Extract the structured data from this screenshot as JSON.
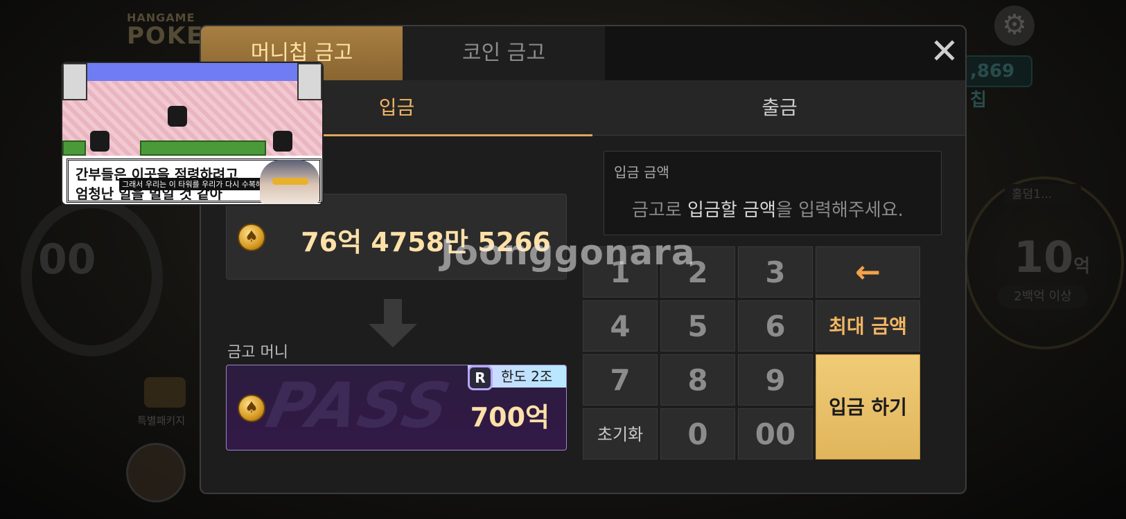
{
  "background": {
    "logo_small": "HANGAME",
    "logo_big": "POKE",
    "chip_pill": ",869 칩",
    "left_amount": "00",
    "right_amount": "10",
    "right_amount_unit": "억",
    "right_sub": "2백억 이상",
    "right_tag": "홀덤1...",
    "package_label": "특별패키지"
  },
  "dialog": {
    "tabs": [
      {
        "label": "머니칩 금고",
        "active": true
      },
      {
        "label": "코인 금고",
        "active": false
      }
    ],
    "close_icon": "close-icon",
    "subtabs": [
      {
        "label": "입금",
        "active": true
      },
      {
        "label": "출금",
        "active": false
      }
    ],
    "current_amount": "76억 4758만 5266",
    "safe_label": "금고 머니",
    "safe_pass_text": "PASS",
    "limit_badge": "한도 2조",
    "limit_icon": "R",
    "safe_amount": "700억",
    "input": {
      "label": "입금 금액",
      "placeholder_prefix": "금고로 ",
      "placeholder_bold": "입금할 금액",
      "placeholder_suffix": "을 입력해주세요."
    },
    "keypad": {
      "k1": "1",
      "k2": "2",
      "k3": "3",
      "k4": "4",
      "k5": "5",
      "k6": "6",
      "k7": "7",
      "k8": "8",
      "k9": "9",
      "k0": "0",
      "k00": "00",
      "reset": "초기화",
      "backspace": "←",
      "max": "최대 금액",
      "confirm": "입금 하기"
    }
  },
  "watermark": "Joonggonara",
  "pip": {
    "line1": "간부들은 이곳을 점령하려고",
    "line2": "엄청난 일을 벌일 것 같아",
    "caption": "그래서 우리는 이 타워를 우리가 다시 수복해야 된다"
  },
  "colors": {
    "accent_gold": "#f3b665",
    "confirm_gold": "#e0b55c",
    "tab_active": "#a77f43"
  }
}
